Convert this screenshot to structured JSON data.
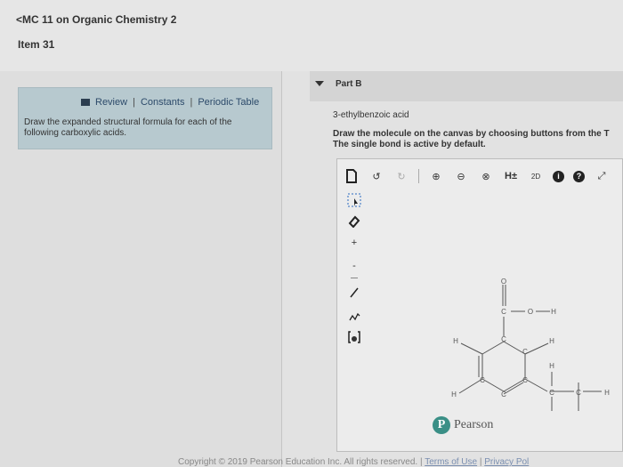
{
  "header": {
    "back_link": "<MC 11 on Organic Chemistry 2",
    "item_title": "Item 31"
  },
  "info_box": {
    "links": [
      "Review",
      "Constants",
      "Periodic Table"
    ],
    "separator": "|",
    "instruction": "Draw the expanded structural formula for each of the following carboxylic acids."
  },
  "part": {
    "label": "Part B",
    "compound": "3-ethylbenzoic acid",
    "instruction_line1": "Draw the molecule on the canvas by choosing buttons from the T",
    "instruction_line2": "The single bond is active by default."
  },
  "toolbar": {
    "undo": "↺",
    "redo": "↻",
    "zoom_in": "⊕",
    "zoom_out": "⊖",
    "zoom_reset": "⊗",
    "hydrogens": "H±",
    "info": "i",
    "help": "?",
    "expand": "⤢",
    "template_icon": "2D"
  },
  "molecule_labels": {
    "carbonyl_o": "O",
    "carboxyl_c": "C",
    "hydroxyl_o": "O",
    "hydroxyl_h": "H",
    "ring_c": "C",
    "h": "H"
  },
  "brand": {
    "name": "Pearson",
    "logo_letter": "P"
  },
  "footer": {
    "copyright": "Copyright © 2019 Pearson Education Inc. All rights reserved.",
    "separator": "|",
    "terms": "Terms of Use",
    "privacy": "Privacy Pol"
  }
}
